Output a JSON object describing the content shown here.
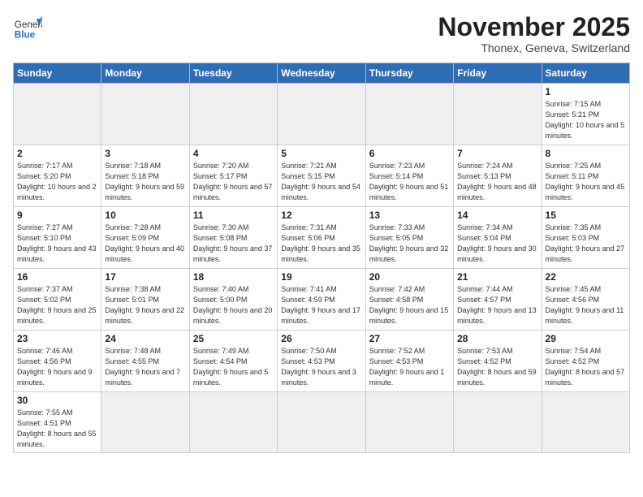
{
  "logo": {
    "text_general": "General",
    "text_blue": "Blue"
  },
  "title": "November 2025",
  "subtitle": "Thonex, Geneva, Switzerland",
  "days_of_week": [
    "Sunday",
    "Monday",
    "Tuesday",
    "Wednesday",
    "Thursday",
    "Friday",
    "Saturday"
  ],
  "weeks": [
    [
      {
        "day": "",
        "info": "",
        "empty": true
      },
      {
        "day": "",
        "info": "",
        "empty": true
      },
      {
        "day": "",
        "info": "",
        "empty": true
      },
      {
        "day": "",
        "info": "",
        "empty": true
      },
      {
        "day": "",
        "info": "",
        "empty": true
      },
      {
        "day": "",
        "info": "",
        "empty": true
      },
      {
        "day": "1",
        "info": "Sunrise: 7:15 AM\nSunset: 5:21 PM\nDaylight: 10 hours\nand 5 minutes."
      }
    ],
    [
      {
        "day": "2",
        "info": "Sunrise: 7:17 AM\nSunset: 5:20 PM\nDaylight: 10 hours\nand 2 minutes."
      },
      {
        "day": "3",
        "info": "Sunrise: 7:18 AM\nSunset: 5:18 PM\nDaylight: 9 hours\nand 59 minutes."
      },
      {
        "day": "4",
        "info": "Sunrise: 7:20 AM\nSunset: 5:17 PM\nDaylight: 9 hours\nand 57 minutes."
      },
      {
        "day": "5",
        "info": "Sunrise: 7:21 AM\nSunset: 5:15 PM\nDaylight: 9 hours\nand 54 minutes."
      },
      {
        "day": "6",
        "info": "Sunrise: 7:23 AM\nSunset: 5:14 PM\nDaylight: 9 hours\nand 51 minutes."
      },
      {
        "day": "7",
        "info": "Sunrise: 7:24 AM\nSunset: 5:13 PM\nDaylight: 9 hours\nand 48 minutes."
      },
      {
        "day": "8",
        "info": "Sunrise: 7:25 AM\nSunset: 5:11 PM\nDaylight: 9 hours\nand 45 minutes."
      }
    ],
    [
      {
        "day": "9",
        "info": "Sunrise: 7:27 AM\nSunset: 5:10 PM\nDaylight: 9 hours\nand 43 minutes."
      },
      {
        "day": "10",
        "info": "Sunrise: 7:28 AM\nSunset: 5:09 PM\nDaylight: 9 hours\nand 40 minutes."
      },
      {
        "day": "11",
        "info": "Sunrise: 7:30 AM\nSunset: 5:08 PM\nDaylight: 9 hours\nand 37 minutes."
      },
      {
        "day": "12",
        "info": "Sunrise: 7:31 AM\nSunset: 5:06 PM\nDaylight: 9 hours\nand 35 minutes."
      },
      {
        "day": "13",
        "info": "Sunrise: 7:33 AM\nSunset: 5:05 PM\nDaylight: 9 hours\nand 32 minutes."
      },
      {
        "day": "14",
        "info": "Sunrise: 7:34 AM\nSunset: 5:04 PM\nDaylight: 9 hours\nand 30 minutes."
      },
      {
        "day": "15",
        "info": "Sunrise: 7:35 AM\nSunset: 5:03 PM\nDaylight: 9 hours\nand 27 minutes."
      }
    ],
    [
      {
        "day": "16",
        "info": "Sunrise: 7:37 AM\nSunset: 5:02 PM\nDaylight: 9 hours\nand 25 minutes."
      },
      {
        "day": "17",
        "info": "Sunrise: 7:38 AM\nSunset: 5:01 PM\nDaylight: 9 hours\nand 22 minutes."
      },
      {
        "day": "18",
        "info": "Sunrise: 7:40 AM\nSunset: 5:00 PM\nDaylight: 9 hours\nand 20 minutes."
      },
      {
        "day": "19",
        "info": "Sunrise: 7:41 AM\nSunset: 4:59 PM\nDaylight: 9 hours\nand 17 minutes."
      },
      {
        "day": "20",
        "info": "Sunrise: 7:42 AM\nSunset: 4:58 PM\nDaylight: 9 hours\nand 15 minutes."
      },
      {
        "day": "21",
        "info": "Sunrise: 7:44 AM\nSunset: 4:57 PM\nDaylight: 9 hours\nand 13 minutes."
      },
      {
        "day": "22",
        "info": "Sunrise: 7:45 AM\nSunset: 4:56 PM\nDaylight: 9 hours\nand 11 minutes."
      }
    ],
    [
      {
        "day": "23",
        "info": "Sunrise: 7:46 AM\nSunset: 4:56 PM\nDaylight: 9 hours\nand 9 minutes."
      },
      {
        "day": "24",
        "info": "Sunrise: 7:48 AM\nSunset: 4:55 PM\nDaylight: 9 hours\nand 7 minutes."
      },
      {
        "day": "25",
        "info": "Sunrise: 7:49 AM\nSunset: 4:54 PM\nDaylight: 9 hours\nand 5 minutes."
      },
      {
        "day": "26",
        "info": "Sunrise: 7:50 AM\nSunset: 4:53 PM\nDaylight: 9 hours\nand 3 minutes."
      },
      {
        "day": "27",
        "info": "Sunrise: 7:52 AM\nSunset: 4:53 PM\nDaylight: 9 hours\nand 1 minute."
      },
      {
        "day": "28",
        "info": "Sunrise: 7:53 AM\nSunset: 4:52 PM\nDaylight: 8 hours\nand 59 minutes."
      },
      {
        "day": "29",
        "info": "Sunrise: 7:54 AM\nSunset: 4:52 PM\nDaylight: 8 hours\nand 57 minutes."
      }
    ],
    [
      {
        "day": "30",
        "info": "Sunrise: 7:55 AM\nSunset: 4:51 PM\nDaylight: 8 hours\nand 55 minutes."
      },
      {
        "day": "",
        "info": "",
        "empty": true
      },
      {
        "day": "",
        "info": "",
        "empty": true
      },
      {
        "day": "",
        "info": "",
        "empty": true
      },
      {
        "day": "",
        "info": "",
        "empty": true
      },
      {
        "day": "",
        "info": "",
        "empty": true
      },
      {
        "day": "",
        "info": "",
        "empty": true
      }
    ]
  ]
}
